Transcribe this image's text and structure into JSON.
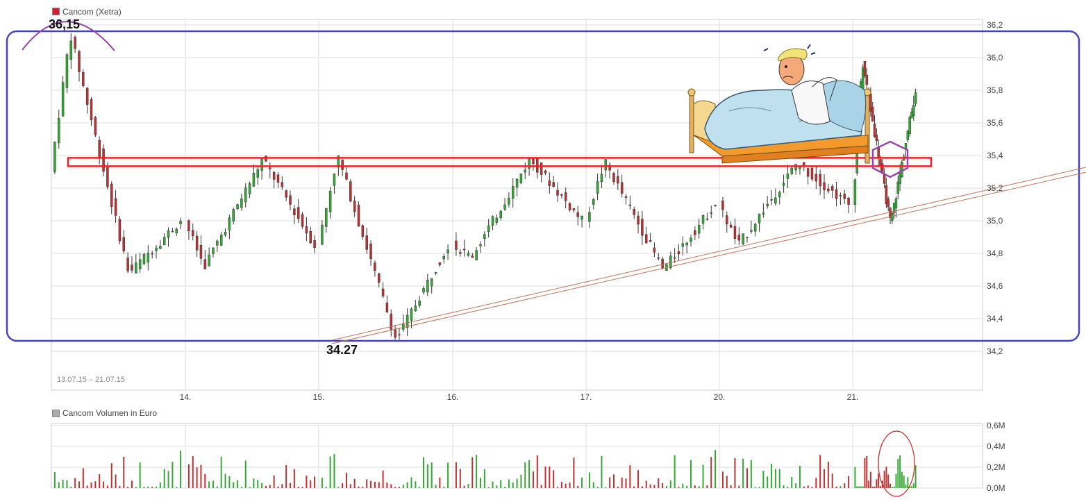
{
  "price_legend": "Cancom (Xetra)",
  "volume_legend": "Cancom Volumen in Euro",
  "date_range": "13.07.15 – 21.07.15",
  "high_annotation": "36,15",
  "low_annotation": "34.27",
  "colors": {
    "up": "#33aa33",
    "down": "#bb3333",
    "grid": "#dddddd",
    "annotation_box": "#4444bb",
    "resistance": "#ee2222",
    "trendline": "#b9735a",
    "marker": "#9944aa",
    "legend_price": "#cc2233",
    "legend_volume": "#aaaaaa"
  },
  "chart_data": [
    {
      "type": "candlestick",
      "title": "Cancom (Xetra)",
      "x_ticks": [
        "14.",
        "15.",
        "16.",
        "17.",
        "20.",
        "21."
      ],
      "y_ticks": [
        "34,2",
        "34,4",
        "34,6",
        "34,8",
        "35,0",
        "35,2",
        "35,4",
        "35,6",
        "35,8",
        "36,0",
        "36,2"
      ],
      "ylim": [
        34.0,
        36.3
      ],
      "grid": true,
      "annotations": {
        "high": 36.15,
        "low": 34.27,
        "resistance_level": 35.36
      },
      "daily_ohlc": [
        {
          "day": "13.",
          "open": 35.3,
          "high": 36.15,
          "low": 34.68,
          "close": 35.0
        },
        {
          "day": "14.",
          "open": 35.0,
          "high": 35.38,
          "low": 34.72,
          "close": 34.85
        },
        {
          "day": "15.",
          "open": 34.85,
          "high": 35.4,
          "low": 34.27,
          "close": 34.85
        },
        {
          "day": "16.",
          "open": 34.85,
          "high": 35.38,
          "low": 34.78,
          "close": 35.0
        },
        {
          "day": "17.",
          "open": 35.0,
          "high": 35.36,
          "low": 34.7,
          "close": 35.1
        },
        {
          "day": "20.",
          "open": 35.1,
          "high": 35.35,
          "low": 34.85,
          "close": 35.1
        },
        {
          "day": "21.",
          "open": 35.1,
          "high": 35.97,
          "low": 34.98,
          "close": 35.8
        }
      ]
    },
    {
      "type": "bar",
      "title": "Cancom Volumen in Euro",
      "y_ticks": [
        "0,0M",
        "0,2M",
        "0,4M",
        "0,6M"
      ],
      "ylim": [
        0,
        0.6
      ]
    }
  ]
}
